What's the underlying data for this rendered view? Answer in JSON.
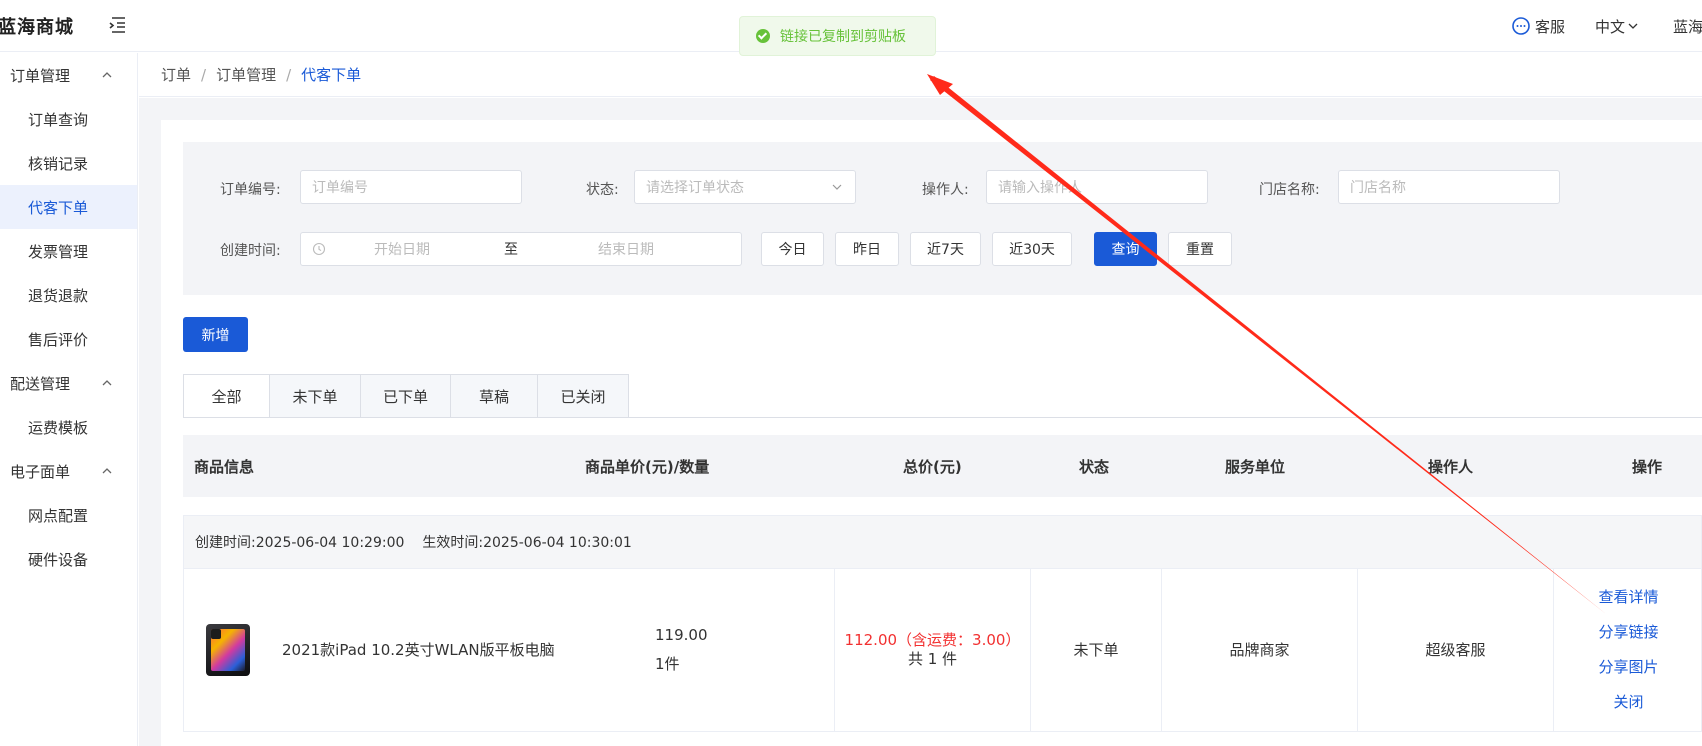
{
  "header": {
    "logo": "蓝海商城",
    "service": "客服",
    "language": "中文",
    "user": "蓝海官"
  },
  "toast": {
    "text": "链接已复制到剪贴板"
  },
  "sidebar": {
    "groups": [
      {
        "label": "订单管理",
        "items": [
          "订单查询",
          "核销记录",
          "代客下单",
          "发票管理",
          "退货退款",
          "售后评价"
        ]
      },
      {
        "label": "配送管理",
        "items": [
          "运费模板"
        ]
      },
      {
        "label": "电子面单",
        "items": [
          "网点配置",
          "硬件设备"
        ]
      }
    ],
    "active_item": "代客下单"
  },
  "breadcrumb": [
    "订单",
    "订单管理",
    "代客下单"
  ],
  "filter": {
    "order_no_label": "订单编号:",
    "order_no_placeholder": "订单编号",
    "status_label": "状态:",
    "status_placeholder": "请选择订单状态",
    "operator_label": "操作人:",
    "operator_placeholder": "请输入操作人",
    "store_label": "门店名称:",
    "store_placeholder": "门店名称",
    "created_label": "创建时间:",
    "start_placeholder": "开始日期",
    "range_sep": "至",
    "end_placeholder": "结束日期",
    "quick": [
      "今日",
      "昨日",
      "近7天",
      "近30天"
    ],
    "search_btn": "查询",
    "reset_btn": "重置"
  },
  "new_btn": "新增",
  "tabs": [
    "全部",
    "未下单",
    "已下单",
    "草稿",
    "已关闭"
  ],
  "table": {
    "headers": {
      "product": "商品信息",
      "price_qty": "商品单价(元)/数量",
      "total": "总价(元)",
      "status": "状态",
      "service_unit": "服务单位",
      "operator": "操作人",
      "actions": "操作"
    },
    "orders": [
      {
        "created": "创建时间:2025-06-04 10:29:00",
        "effective": "生效时间:2025-06-04 10:30:01",
        "product_name": "2021款iPad 10.2英寸WLAN版平板电脑",
        "unit_price": "119.00",
        "quantity": "1件",
        "total": "112.00（含运费：3.00）",
        "total_count": "共 1 件",
        "status": "未下单",
        "service_unit": "品牌商家",
        "operator": "超级客服",
        "actions": [
          "查看详情",
          "分享链接",
          "分享图片",
          "关闭"
        ]
      }
    ]
  },
  "colors": {
    "primary": "#1a5ad7",
    "success": "#67c23a",
    "price_red": "#f23030",
    "arrow_red": "#ff2a1a"
  }
}
